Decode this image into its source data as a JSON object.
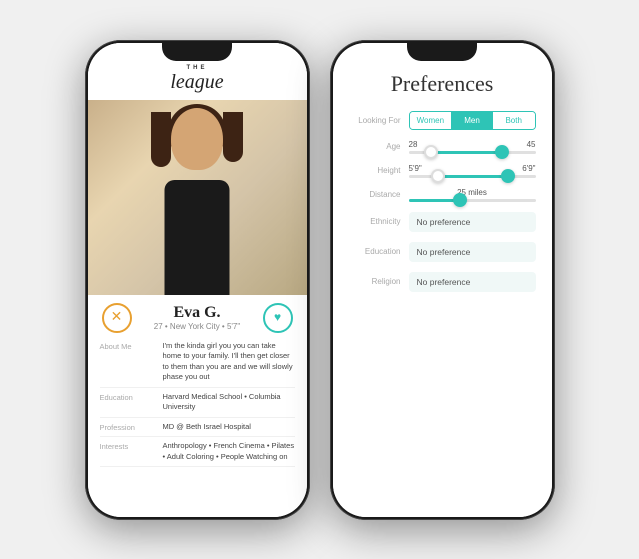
{
  "phone1": {
    "logo_small": "THE",
    "logo_main": "league",
    "profile": {
      "name": "Eva G.",
      "details": "27  •  New York City  •  5'7\"",
      "about_label": "About Me",
      "about_text": "I'm the kinda girl you you can take home to your family. I'll then get closer to them than you are and we will slowly phase you out",
      "education_label": "Education",
      "education_text": "Harvard Medical School • Columbia University",
      "profession_label": "Profession",
      "profession_text": "MD @ Beth Israel Hospital",
      "interests_label": "Interests",
      "interests_text": "Anthropology • French Cinema • Pilates • Adult Coloring • People Watching on"
    }
  },
  "phone2": {
    "title": "Preferences",
    "looking_for_label": "Looking For",
    "gender_options": [
      "Women",
      "Men",
      "Both"
    ],
    "active_gender": "Men",
    "age_label": "Age",
    "age_min": "28",
    "age_max": "45",
    "height_label": "Height",
    "height_min": "5'9\"",
    "height_max": "6'9\"",
    "distance_label": "Distance",
    "distance_value": "25 miles",
    "ethnicity_label": "Ethnicity",
    "ethnicity_value": "No preference",
    "education_label": "Education",
    "education_value": "No preference",
    "religion_label": "Religion",
    "religion_value": "No preference"
  }
}
